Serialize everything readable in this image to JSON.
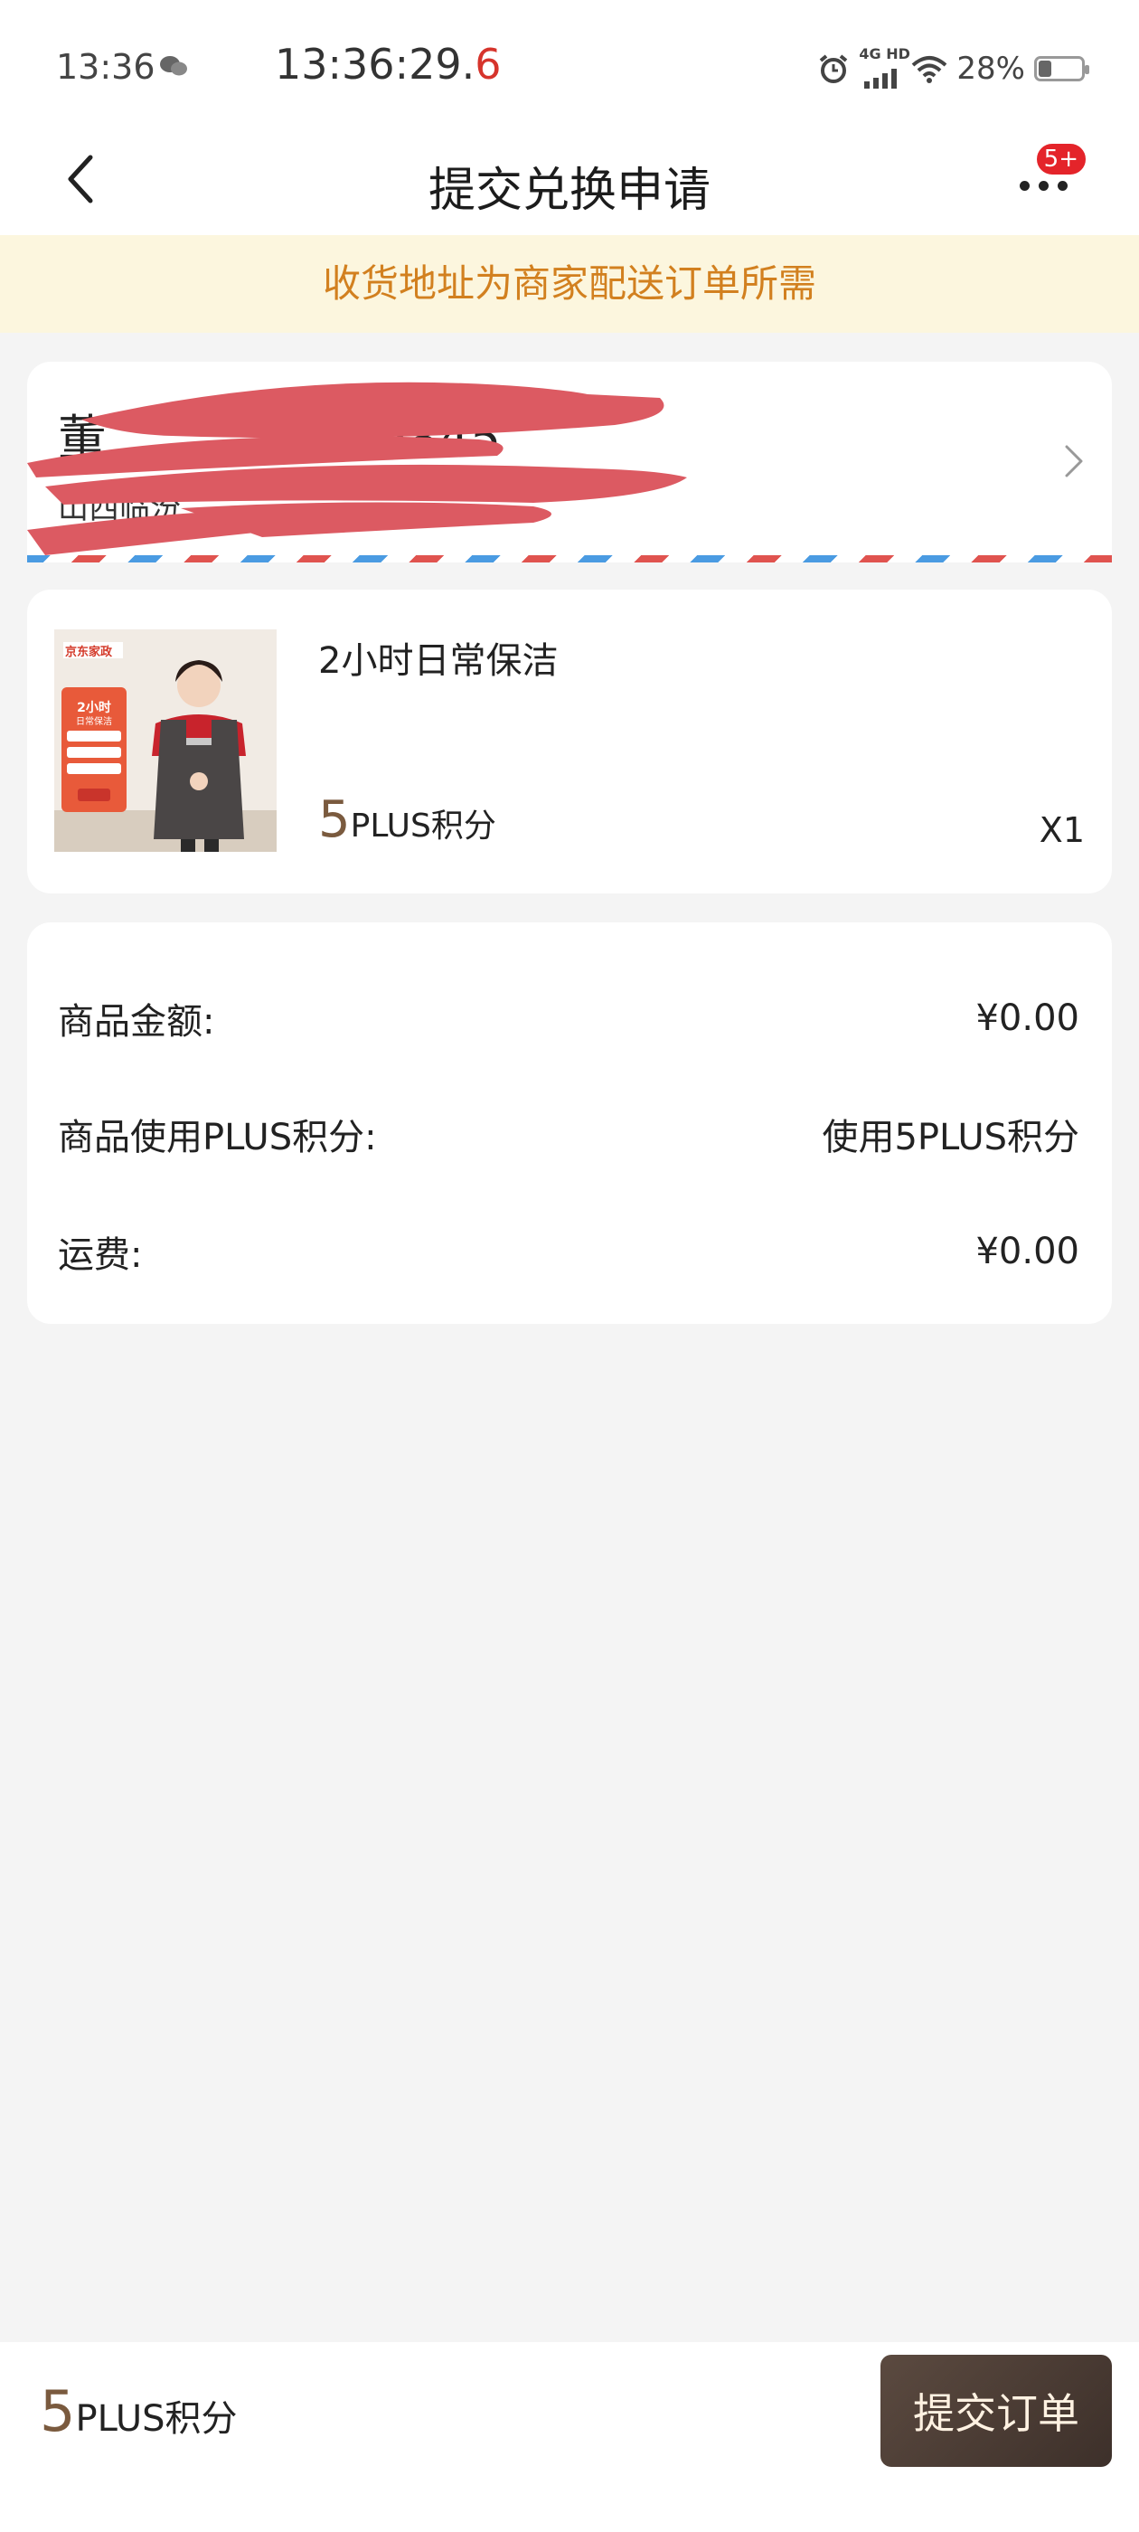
{
  "status_bar": {
    "time": "13:36",
    "clock_main": "13:36:29.",
    "clock_tenth": "6",
    "network": "4G HD",
    "battery": "28%",
    "battery_level": 0.28
  },
  "nav": {
    "title": "提交兑换申请",
    "more_badge": "5+"
  },
  "notice": {
    "text": "收货地址为商家配送订单所需"
  },
  "address": {
    "name_visible": "董",
    "phone_visible": "426845",
    "line_visible": "山西临汾"
  },
  "product": {
    "name": "2小时日常保洁",
    "price_number": "5",
    "price_unit": "PLUS积分",
    "quantity": "X1",
    "image_brand": "京东家政",
    "image_headline": "2小时",
    "image_sub": "日常保洁"
  },
  "summary": {
    "rows": [
      {
        "label": "商品金额:",
        "value": "¥0.00"
      },
      {
        "label": "商品使用PLUS积分:",
        "value": "使用5PLUS积分"
      },
      {
        "label": "运费:",
        "value": "¥0.00"
      }
    ]
  },
  "bottom": {
    "total_number": "5",
    "total_unit": "PLUS积分",
    "submit_label": "提交订单"
  },
  "colors": {
    "accent_brown": "#7a5a3e",
    "notice_text": "#d2801f",
    "notice_bg": "#fcf6de",
    "badge_red": "#e4242a",
    "button_bg": "#4a3b33"
  }
}
